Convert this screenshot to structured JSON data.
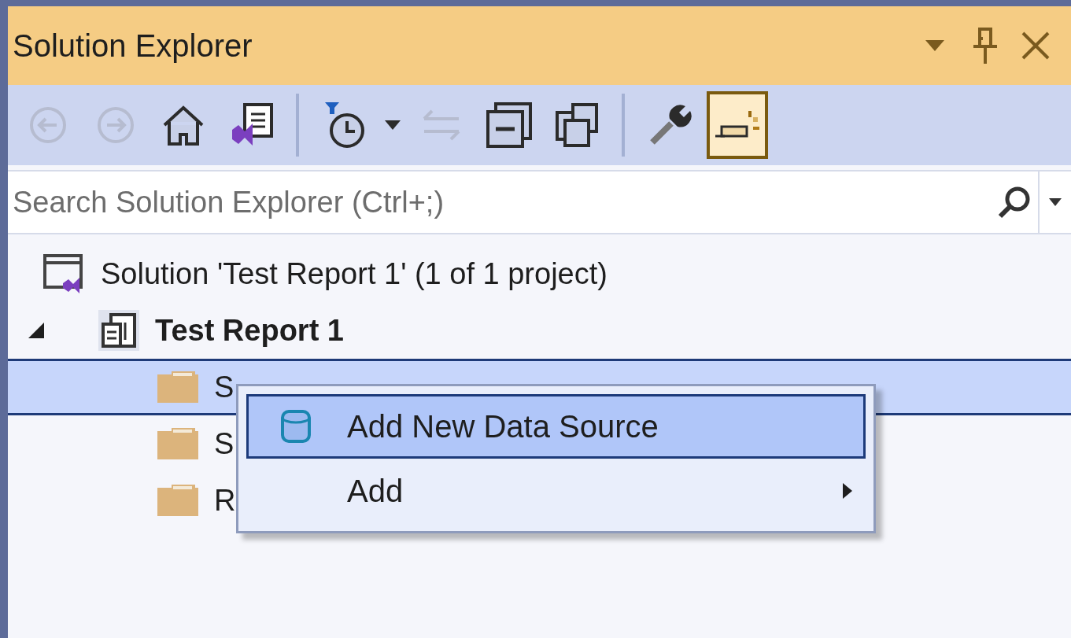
{
  "window": {
    "title": "Solution Explorer"
  },
  "toolbar": [
    {
      "kind": "back",
      "disabled": true,
      "on": false
    },
    {
      "kind": "forward",
      "disabled": true,
      "on": false
    },
    {
      "kind": "home",
      "disabled": false,
      "on": false
    },
    {
      "kind": "switch",
      "disabled": false,
      "on": false
    },
    {
      "kind": "separator"
    },
    {
      "kind": "pending",
      "disabled": false,
      "on": false
    },
    {
      "kind": "dropdown",
      "disabled": false,
      "on": false
    },
    {
      "kind": "sync",
      "disabled": true,
      "on": false
    },
    {
      "kind": "collapse",
      "disabled": false,
      "on": false
    },
    {
      "kind": "copies",
      "disabled": false,
      "on": false
    },
    {
      "kind": "separator"
    },
    {
      "kind": "properties",
      "disabled": false,
      "on": false
    },
    {
      "kind": "preview",
      "disabled": false,
      "on": true
    }
  ],
  "search": {
    "placeholder": "Search Solution Explorer (Ctrl+;)"
  },
  "tree": [
    {
      "kind": "solution",
      "label": "Solution 'Test Report 1' (1 of 1 project)",
      "selected": false,
      "children": [
        {
          "kind": "project",
          "label": "Test Report 1",
          "selected": false,
          "expanded": true,
          "children": [
            {
              "kind": "folder",
              "label": "S",
              "selected": true
            },
            {
              "kind": "folder",
              "label": "S",
              "selected": false
            },
            {
              "kind": "folder",
              "label": "R",
              "selected": false
            }
          ]
        }
      ]
    }
  ],
  "context_menu": [
    {
      "kind": "datasource",
      "label": "Add New Data Source",
      "selected": true,
      "submenu": false
    },
    {
      "kind": "plain",
      "label": "Add",
      "selected": false,
      "submenu": true
    }
  ]
}
